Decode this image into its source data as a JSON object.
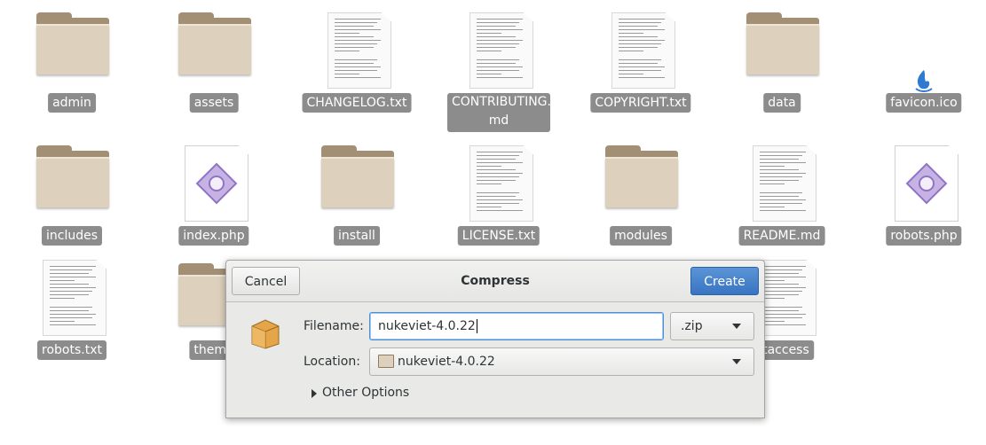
{
  "files": [
    {
      "name": "admin",
      "type": "folder"
    },
    {
      "name": "assets",
      "type": "folder"
    },
    {
      "name": "CHANGELOG.txt",
      "type": "text"
    },
    {
      "name": "CONTRIBUTING.md",
      "type": "text"
    },
    {
      "name": "COPYRIGHT.txt",
      "type": "text"
    },
    {
      "name": "data",
      "type": "folder"
    },
    {
      "name": "favicon.ico",
      "type": "image"
    },
    {
      "name": "includes",
      "type": "folder"
    },
    {
      "name": "index.php",
      "type": "php"
    },
    {
      "name": "install",
      "type": "folder"
    },
    {
      "name": "LICENSE.txt",
      "type": "text"
    },
    {
      "name": "modules",
      "type": "folder"
    },
    {
      "name": "README.md",
      "type": "text"
    },
    {
      "name": "robots.php",
      "type": "php"
    },
    {
      "name": "robots.txt",
      "type": "text"
    },
    {
      "name": "theme",
      "type": "folder"
    },
    {
      "name": "htaccess",
      "type": "text"
    }
  ],
  "contributing_label": "CONTRIBUTING.\nmd",
  "dialog": {
    "title": "Compress",
    "cancel_label": "Cancel",
    "create_label": "Create",
    "filename_label": "Filename:",
    "filename_value": "nukeviet-4.0.22",
    "extension": ".zip",
    "location_label": "Location:",
    "location_value": "nukeviet-4.0.22",
    "other_options_label": "Other Options"
  },
  "colors": {
    "accent": "#3874c2",
    "label_bg": "#8c8c8c",
    "folder_front": "#ddd0bc",
    "folder_back": "#a38f73"
  }
}
